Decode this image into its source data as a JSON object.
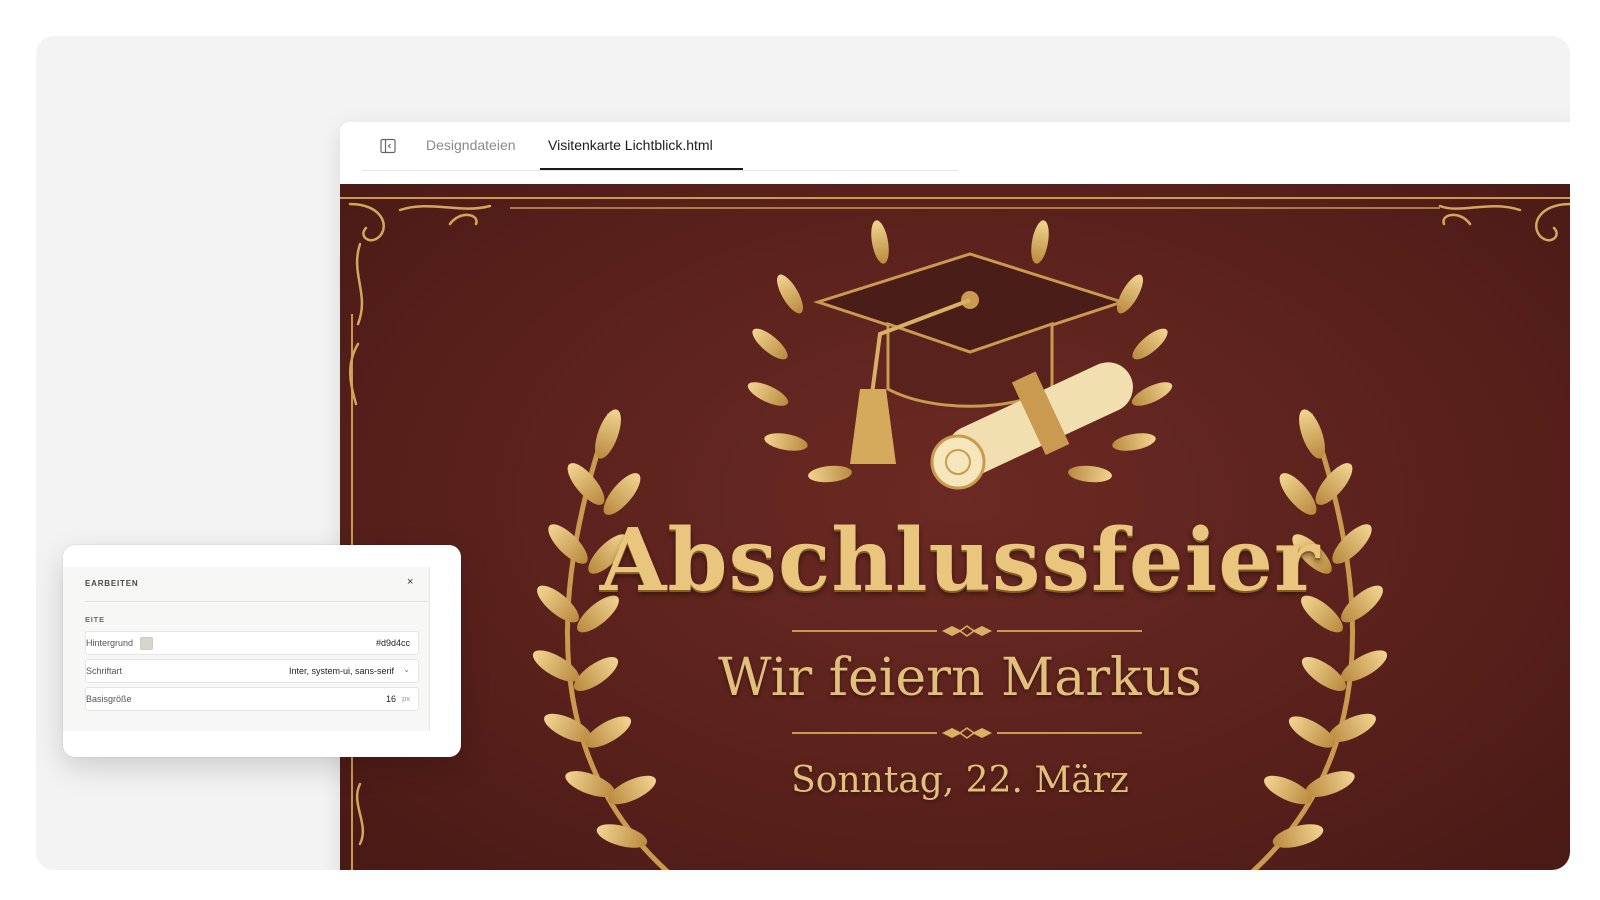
{
  "tabs": {
    "panel_toggle": "sidebar-toggle-icon",
    "items": [
      "Designdateien",
      "Visitenkarte Lichtblick.html"
    ],
    "active_index": 1
  },
  "card": {
    "title": "Abschlussfeier",
    "subtitle": "Wir feiern Markus",
    "date": "Sonntag, 22. März",
    "colors": {
      "background": "#5a211c",
      "gold": "#e9c57d"
    },
    "emblem": "graduation-cap-and-diploma-with-laurel-wreath"
  },
  "editor": {
    "title": "EARBEITEN",
    "close_label": "×",
    "section_label": "EITE",
    "fields": {
      "background": {
        "label": "Hintergrund",
        "value": "#d9d4cc"
      },
      "font": {
        "label": "Schriftart",
        "value": "Inter, system-ui, sans-serif"
      },
      "base_size": {
        "label": "Basisgröße",
        "value": "16",
        "unit": "px"
      }
    }
  }
}
